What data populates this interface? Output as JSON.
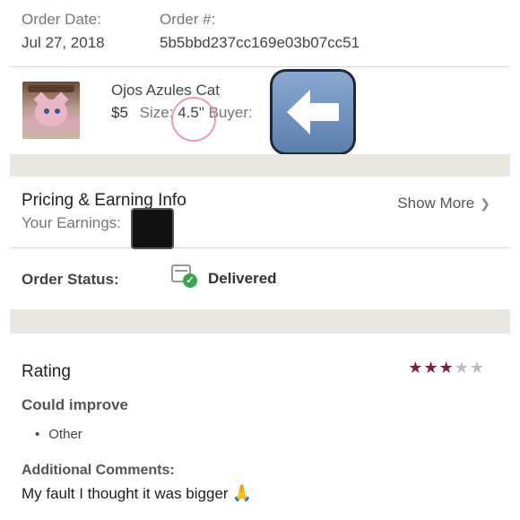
{
  "order": {
    "date_label": "Order Date:",
    "date_value": "Jul 27, 2018",
    "number_label": "Order #:",
    "number_value": "5b5bbd237cc169e03b07cc51"
  },
  "product": {
    "title": "Ojos Azules Cat",
    "price": "$5",
    "size_label": "Size:",
    "size_value": "4.5\"",
    "buyer_label": "Buyer:",
    "thumbnail_icon": "cat-pillow-thumbnail"
  },
  "pricing": {
    "title": "Pricing & Earning Info",
    "earnings_label": "Your Earnings:",
    "show_more_label": "Show More",
    "chevron_icon": "chevron-down-icon"
  },
  "status": {
    "label": "Order Status:",
    "value": "Delivered",
    "status_color": "#3aa551"
  },
  "rating": {
    "title": "Rating",
    "stars_filled": 3,
    "stars_total": 5,
    "star_color": "#7a2237",
    "improve_title": "Could improve",
    "improve_items": [
      "Other"
    ],
    "comments_label": "Additional Comments:",
    "comments_text": "My fault I thought it was bigger",
    "comments_emoji": "🙏"
  },
  "overlay": {
    "arrow_icon": "left-arrow-emoji-icon",
    "censor": "black-square-icon"
  }
}
